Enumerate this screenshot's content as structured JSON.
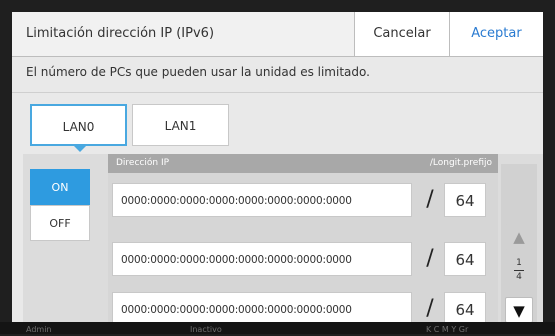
{
  "header": {
    "title": "Limitación dirección IP (IPv6)",
    "cancel_label": "Cancelar",
    "accept_label": "Aceptar"
  },
  "description": "El número de PCs que pueden usar la unidad es limitado.",
  "tabs": [
    {
      "label": "LAN0",
      "selected": true
    },
    {
      "label": "LAN1",
      "selected": false
    }
  ],
  "toggle": {
    "on_label": "ON",
    "off_label": "OFF",
    "value": "ON"
  },
  "list": {
    "ip_header": "Dirección IP",
    "prefix_header": "/Longit.prefijo",
    "slash": "/",
    "rows": [
      {
        "ip": "0000:0000:0000:0000:0000:0000:0000:0000",
        "prefix": "64"
      },
      {
        "ip": "0000:0000:0000:0000:0000:0000:0000:0000",
        "prefix": "64"
      },
      {
        "ip": "0000:0000:0000:0000:0000:0000:0000:0000",
        "prefix": "64"
      }
    ]
  },
  "pager": {
    "current": "1",
    "total": "4",
    "up_icon": "▲",
    "down_icon": "▼"
  },
  "footer": {
    "user": "Admin",
    "status": "Inactivo",
    "inks": "K C M Y Gr"
  },
  "colors": {
    "accent": "#2e9be0",
    "accept_text": "#2a7bd1",
    "selected_tab_border": "#49a8e0"
  }
}
